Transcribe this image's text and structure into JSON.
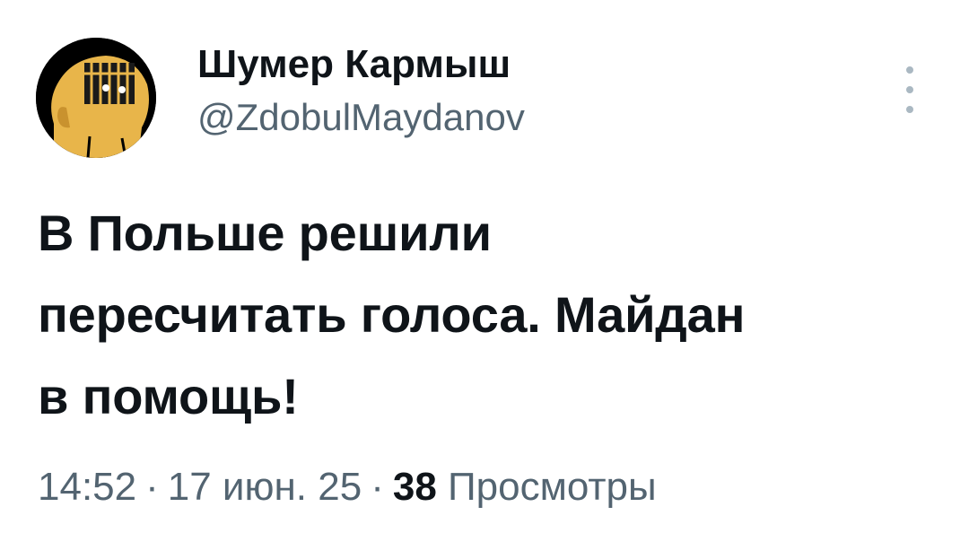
{
  "author": {
    "display_name": "Шумер Кармыш",
    "handle": "@ZdobulMaydanov"
  },
  "tweet": {
    "lines": [
      "В Польше решили",
      "пересчитать голоса. Майдан",
      "в помощь!"
    ]
  },
  "meta": {
    "time": "14:52",
    "separator": "·",
    "date": "17 июн. 25",
    "views_count": "38",
    "views_label": "Просмотры"
  },
  "icons": {
    "more": "more-vertical-icon",
    "avatar": "avatar-image"
  },
  "colors": {
    "text_primary": "#0f1419",
    "text_secondary": "#536471",
    "avatar_skin": "#e8b54a"
  }
}
